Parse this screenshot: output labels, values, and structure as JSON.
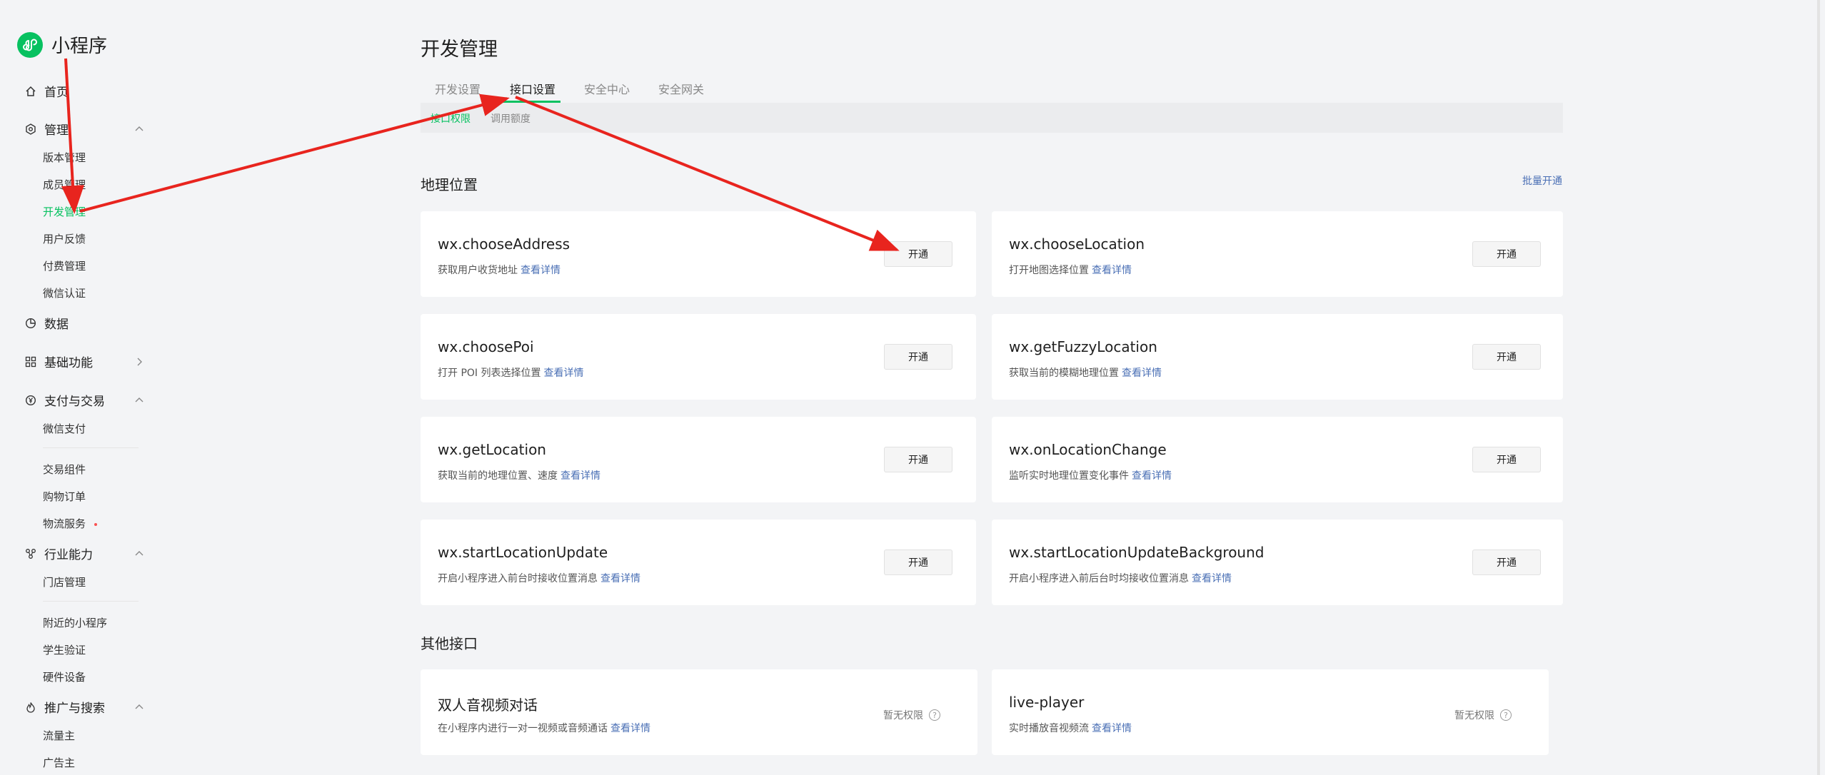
{
  "brand": {
    "name": "小程序",
    "accent": "#07c160"
  },
  "sidebar": {
    "home": "首页",
    "manage": {
      "label": "管理",
      "items": [
        "版本管理",
        "成员管理",
        "开发管理",
        "用户反馈",
        "付费管理",
        "微信认证"
      ]
    },
    "data": "数据",
    "basic": "基础功能",
    "pay": {
      "label": "支付与交易",
      "items": [
        "微信支付",
        "交易组件",
        "购物订单",
        "物流服务"
      ]
    },
    "industry": {
      "label": "行业能力",
      "items": [
        "门店管理",
        "附近的小程序",
        "学生验证",
        "硬件设备"
      ]
    },
    "promote": {
      "label": "推广与搜索",
      "items": [
        "流量主",
        "广告主"
      ]
    }
  },
  "page": {
    "title": "开发管理"
  },
  "tabs": [
    "开发设置",
    "接口设置",
    "安全中心",
    "安全网关"
  ],
  "subtabs": [
    "接口权限",
    "调用额度"
  ],
  "location": {
    "title": "地理位置",
    "batch": "批量开通",
    "apis": [
      {
        "name": "wx.chooseAddress",
        "desc": "获取用户收货地址"
      },
      {
        "name": "wx.chooseLocation",
        "desc": "打开地图选择位置"
      },
      {
        "name": "wx.choosePoi",
        "desc": "打开 POI 列表选择位置"
      },
      {
        "name": "wx.getFuzzyLocation",
        "desc": "获取当前的模糊地理位置"
      },
      {
        "name": "wx.getLocation",
        "desc": "获取当前的地理位置、速度"
      },
      {
        "name": "wx.onLocationChange",
        "desc": "监听实时地理位置变化事件"
      },
      {
        "name": "wx.startLocationUpdate",
        "desc": "开启小程序进入前台时接收位置消息"
      },
      {
        "name": "wx.startLocationUpdateBackground",
        "desc": "开启小程序进入前后台时均接收位置消息"
      }
    ]
  },
  "other": {
    "title": "其他接口",
    "apis": [
      {
        "name": "双人音视频对话",
        "desc": "在小程序内进行一对一视频或音频通话"
      },
      {
        "name": "live-player",
        "desc": "实时播放音视频流"
      }
    ]
  },
  "labels": {
    "open": "开通",
    "detail": "查看详情",
    "noperm": "暂无权限"
  },
  "colors": {
    "link": "#4a6fb5",
    "annotation": "#e8241e"
  }
}
